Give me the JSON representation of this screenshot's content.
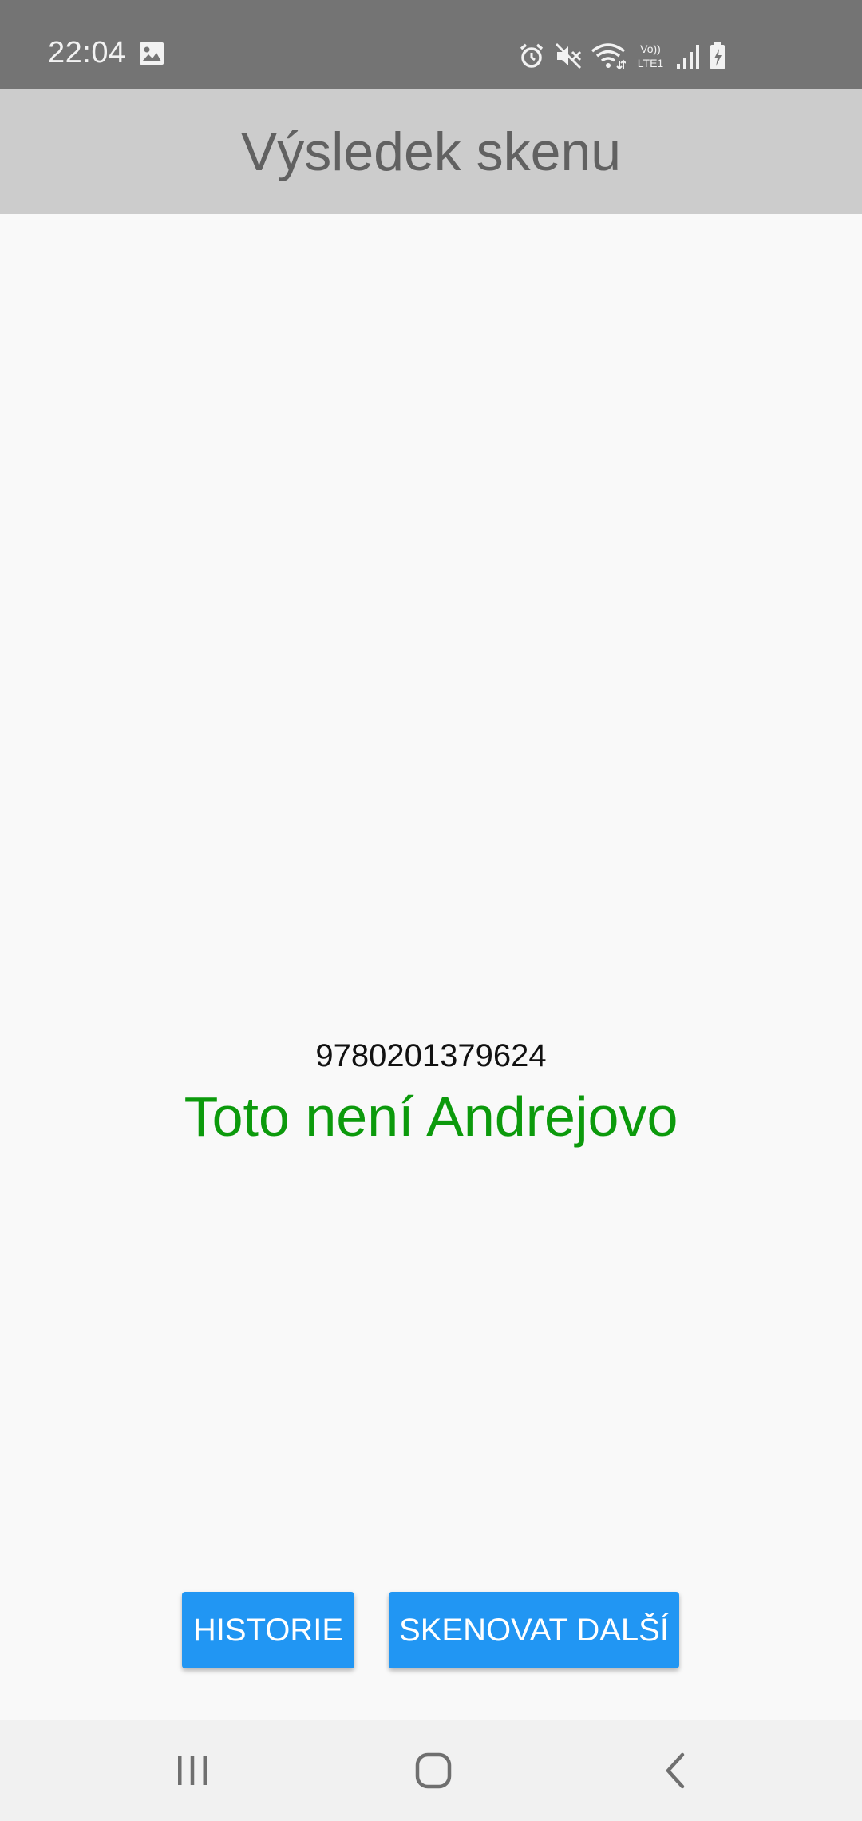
{
  "status_bar": {
    "time": "22:04",
    "icons": [
      "gallery-icon",
      "alarm-icon",
      "mute-icon",
      "wifi-icon",
      "volte-icon",
      "signal-icon",
      "battery-charging-icon"
    ],
    "volte_label_top": "Vo))",
    "volte_label_bottom": "LTE1"
  },
  "app_bar": {
    "title": "Výsledek skenu"
  },
  "result": {
    "code": "9780201379624",
    "message": "Toto není Andrejovo",
    "message_color": "#0c9a0c"
  },
  "actions": {
    "history_label": "HISTORIE",
    "scan_next_label": "SKENOVAT DALŠÍ",
    "button_color": "#2196f3"
  },
  "nav_bar": {
    "buttons": [
      "recents-icon",
      "home-icon",
      "back-icon"
    ]
  }
}
